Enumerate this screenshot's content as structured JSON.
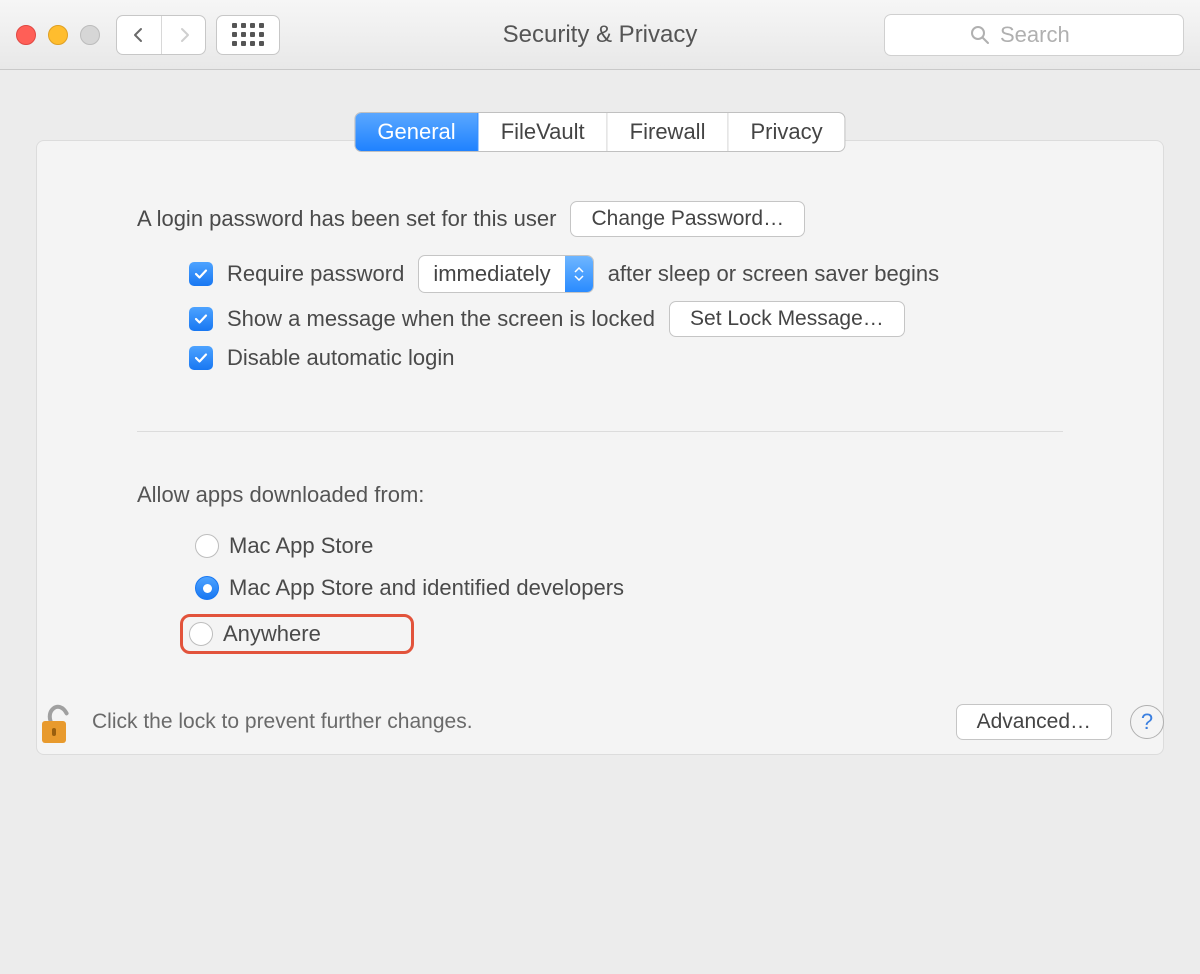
{
  "window": {
    "title": "Security & Privacy"
  },
  "search": {
    "placeholder": "Search"
  },
  "tabs": {
    "general": "General",
    "filevault": "FileVault",
    "firewall": "Firewall",
    "privacy": "Privacy"
  },
  "general": {
    "login_password_text": "A login password has been set for this user",
    "change_password_label": "Change Password…",
    "require_password_prefix": "Require password",
    "require_password_popup": "immediately",
    "require_password_suffix": "after sleep or screen saver begins",
    "show_message_label": "Show a message when the screen is locked",
    "set_lock_message_label": "Set Lock Message…",
    "disable_auto_login_label": "Disable automatic login",
    "allow_apps_label": "Allow apps downloaded from:",
    "radio_options": {
      "app_store": "Mac App Store",
      "identified": "Mac App Store and identified developers",
      "anywhere": "Anywhere"
    }
  },
  "footer": {
    "lock_text": "Click the lock to prevent further changes.",
    "advanced_label": "Advanced…",
    "help_label": "?"
  }
}
